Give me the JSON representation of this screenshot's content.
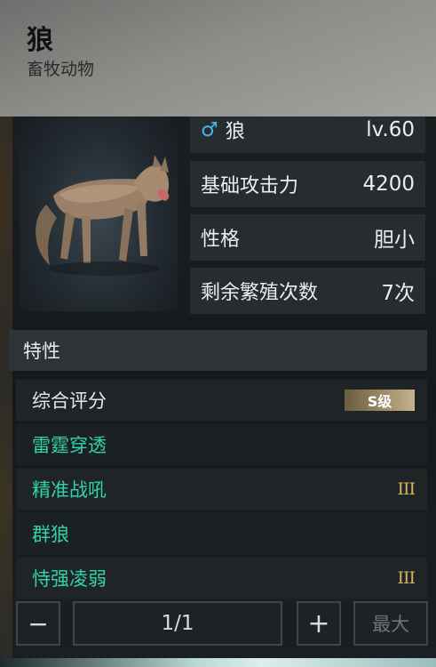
{
  "header": {
    "name": "狼",
    "category": "畜牧动物"
  },
  "stats": [
    {
      "label": "狼",
      "value": "lv.60",
      "gender": "♂"
    },
    {
      "label": "基础攻击力",
      "value": "4200"
    },
    {
      "label": "性格",
      "value": "胆小"
    },
    {
      "label": "剩余繁殖次数",
      "value": "7次"
    }
  ],
  "traits_section": {
    "title": "特性",
    "items": [
      {
        "label": "综合评分",
        "badge": "S级"
      },
      {
        "label": "雷霆穿透",
        "rank": ""
      },
      {
        "label": "精准战吼",
        "rank": "III"
      },
      {
        "label": "群狼",
        "rank": ""
      },
      {
        "label": "恃强凌弱",
        "rank": "III"
      }
    ]
  },
  "controls": {
    "minus": "−",
    "counter": "1/1",
    "plus": "+",
    "max": "最大"
  },
  "colors": {
    "trait_green": "#33d2ac",
    "rank_gold": "#d6b45a",
    "male_blue": "#4ab6e8"
  }
}
